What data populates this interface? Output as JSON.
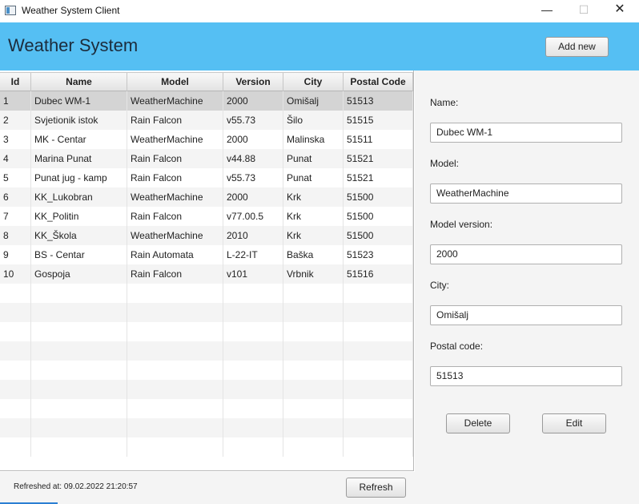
{
  "window": {
    "title": "Weather System Client",
    "minimize_glyph": "—",
    "maximize_glyph": "☐",
    "close_glyph": "✕"
  },
  "header": {
    "title": "Weather System",
    "add_label": "Add new",
    "background_color": "#55bff3"
  },
  "table": {
    "columns": [
      "Id",
      "Name",
      "Model",
      "Version",
      "City",
      "Postal Code"
    ],
    "selected_row": 0,
    "rows": [
      [
        "1",
        "Dubec WM-1",
        "WeatherMachine",
        "2000",
        "Omišalj",
        "51513"
      ],
      [
        "2",
        "Svjetionik istok",
        "Rain Falcon",
        "v55.73",
        "Šilo",
        "51515"
      ],
      [
        "3",
        "MK - Centar",
        "WeatherMachine",
        "2000",
        "Malinska",
        "51511"
      ],
      [
        "4",
        "Marina Punat",
        "Rain Falcon",
        "v44.88",
        "Punat",
        "51521"
      ],
      [
        "5",
        "Punat jug - kamp",
        "Rain Falcon",
        "v55.73",
        "Punat",
        "51521"
      ],
      [
        "6",
        "KK_Lukobran",
        "WeatherMachine",
        "2000",
        "Krk",
        "51500"
      ],
      [
        "7",
        "KK_Politin",
        "Rain Falcon",
        "v77.00.5",
        "Krk",
        "51500"
      ],
      [
        "8",
        "KK_Škola",
        "WeatherMachine",
        "2010",
        "Krk",
        "51500"
      ],
      [
        "9",
        "BS - Centar",
        "Rain Automata",
        "L-22-IT",
        "Baška",
        "51523"
      ],
      [
        "10",
        "Gospoja",
        "Rain Falcon",
        "v101",
        "Vrbnik",
        "51516"
      ]
    ]
  },
  "form": {
    "name_label": "Name:",
    "name_value": "Dubec WM-1",
    "model_label": "Model:",
    "model_value": "WeatherMachine",
    "version_label": "Model version:",
    "version_value": "2000",
    "city_label": "City:",
    "city_value": "Omišalj",
    "postal_label": "Postal code:",
    "postal_value": "51513",
    "delete_label": "Delete",
    "edit_label": "Edit"
  },
  "footer": {
    "refreshed_text": "Refreshed at: 09.02.2022 21:20:57",
    "refresh_label": "Refresh"
  }
}
